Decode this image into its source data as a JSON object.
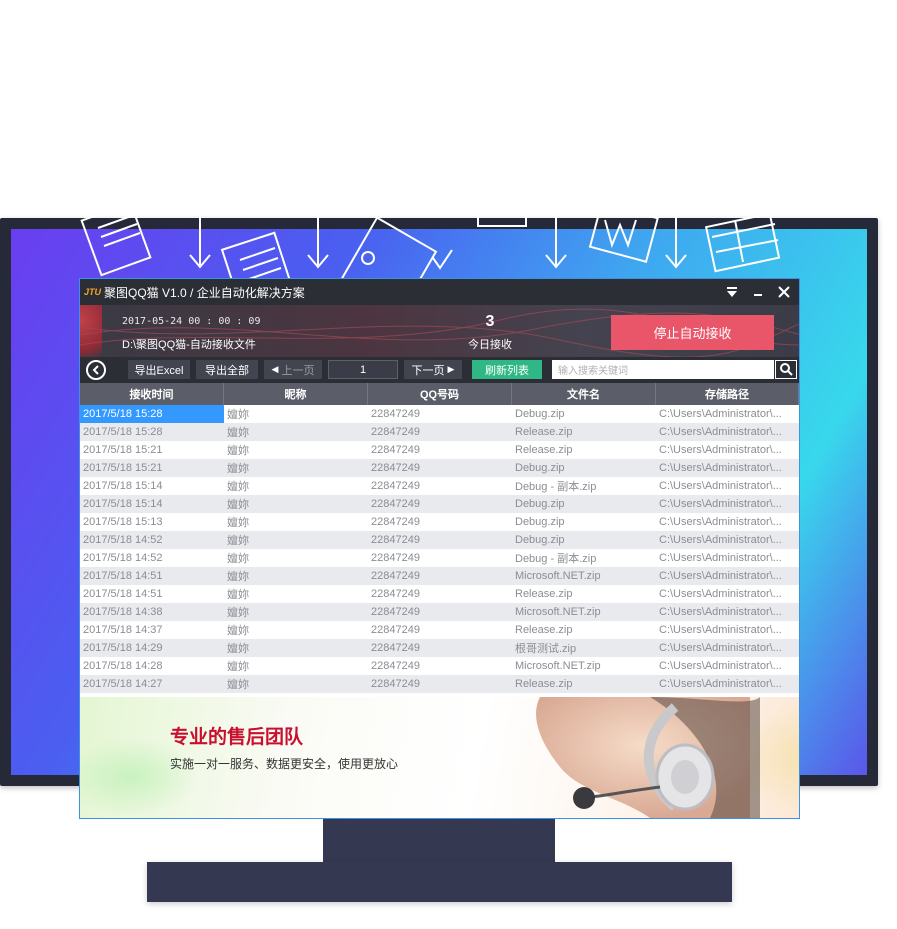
{
  "app": {
    "logo": "JTU",
    "title": "聚图QQ猫 V1.0 / 企业自动化解决方案",
    "window_buttons": {
      "menu_icon": "dropdown-icon",
      "minimize_icon": "minimize-icon",
      "close_icon": "close-icon"
    }
  },
  "header": {
    "datetime": "2017-05-24 00 : 00 : 09",
    "path": "D:\\聚图QQ猫-自动接收文件",
    "count": "3",
    "count_label": "今日接收",
    "stop_button": "停止自动接收"
  },
  "toolbar": {
    "export_excel": "导出Excel",
    "export_all": "导出全部",
    "prev_page": "上一页",
    "page_number": "1",
    "next_page": "下一页",
    "refresh": "刷新列表",
    "search_placeholder": "输入搜索关键词"
  },
  "table": {
    "columns": [
      "接收时间",
      "昵称",
      "QQ号码",
      "文件名",
      "存储路径"
    ],
    "rows": [
      [
        "2017/5/18 15:28",
        "嬗妳",
        "22847249",
        "Debug.zip",
        "C:\\Users\\Administrator\\..."
      ],
      [
        "2017/5/18 15:28",
        "嬗妳",
        "22847249",
        "Release.zip",
        "C:\\Users\\Administrator\\..."
      ],
      [
        "2017/5/18 15:21",
        "嬗妳",
        "22847249",
        "Release.zip",
        "C:\\Users\\Administrator\\..."
      ],
      [
        "2017/5/18 15:21",
        "嬗妳",
        "22847249",
        "Debug.zip",
        "C:\\Users\\Administrator\\..."
      ],
      [
        "2017/5/18 15:14",
        "嬗妳",
        "22847249",
        "Debug - 副本.zip",
        "C:\\Users\\Administrator\\..."
      ],
      [
        "2017/5/18 15:14",
        "嬗妳",
        "22847249",
        "Debug.zip",
        "C:\\Users\\Administrator\\..."
      ],
      [
        "2017/5/18 15:13",
        "嬗妳",
        "22847249",
        "Debug.zip",
        "C:\\Users\\Administrator\\..."
      ],
      [
        "2017/5/18 14:52",
        "嬗妳",
        "22847249",
        "Debug.zip",
        "C:\\Users\\Administrator\\..."
      ],
      [
        "2017/5/18 14:52",
        "嬗妳",
        "22847249",
        "Debug - 副本.zip",
        "C:\\Users\\Administrator\\..."
      ],
      [
        "2017/5/18 14:51",
        "嬗妳",
        "22847249",
        "Microsoft.NET.zip",
        "C:\\Users\\Administrator\\..."
      ],
      [
        "2017/5/18 14:51",
        "嬗妳",
        "22847249",
        "Release.zip",
        "C:\\Users\\Administrator\\..."
      ],
      [
        "2017/5/18 14:38",
        "嬗妳",
        "22847249",
        "Microsoft.NET.zip",
        "C:\\Users\\Administrator\\..."
      ],
      [
        "2017/5/18 14:37",
        "嬗妳",
        "22847249",
        "Release.zip",
        "C:\\Users\\Administrator\\..."
      ],
      [
        "2017/5/18 14:29",
        "嬗妳",
        "22847249",
        "根哥测试.zip",
        "C:\\Users\\Administrator\\..."
      ],
      [
        "2017/5/18 14:28",
        "嬗妳",
        "22847249",
        "Microsoft.NET.zip",
        "C:\\Users\\Administrator\\..."
      ],
      [
        "2017/5/18 14:27",
        "嬗妳",
        "22847249",
        "Release.zip",
        "C:\\Users\\Administrator\\..."
      ]
    ]
  },
  "banner": {
    "title": "专业的售后团队",
    "subtitle": "实施一对一服务、数据更安全，使用更放心"
  },
  "colors": {
    "accent_red": "#e9566a",
    "refresh_green": "#2fb886",
    "selection_blue": "#3399ff",
    "window_border": "#3a93e6"
  }
}
